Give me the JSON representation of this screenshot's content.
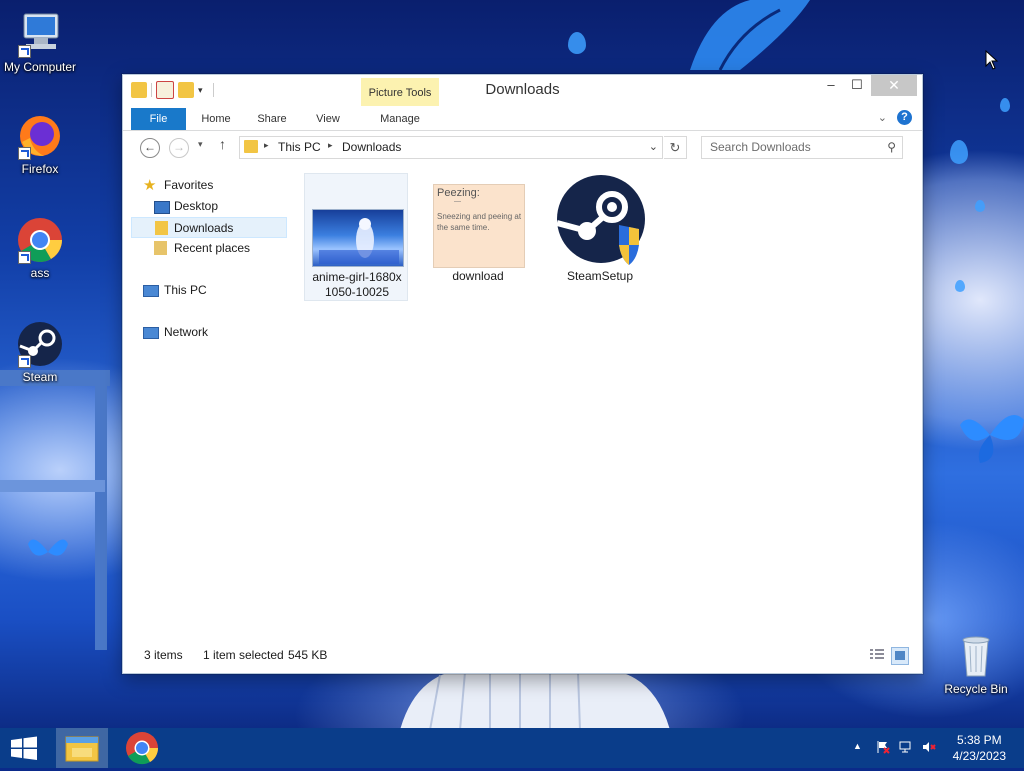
{
  "desktop": {
    "icons": [
      {
        "label": "My Computer",
        "icon": "computer-icon"
      },
      {
        "label": "Firefox",
        "icon": "firefox-icon"
      },
      {
        "label": "ass",
        "icon": "chrome-icon"
      },
      {
        "label": "Steam",
        "icon": "steam-icon"
      },
      {
        "label": "Recycle Bin",
        "icon": "recycle-bin-icon"
      }
    ]
  },
  "window": {
    "title": "Downloads",
    "context_tab": "Picture Tools",
    "ribbon_tabs": [
      "File",
      "Home",
      "Share",
      "View",
      "Manage"
    ],
    "breadcrumb": [
      "This PC",
      "Downloads"
    ],
    "search_placeholder": "Search Downloads",
    "nav_pane": {
      "favorites": "Favorites",
      "items": [
        "Desktop",
        "Downloads",
        "Recent places"
      ],
      "this_pc": "This PC",
      "network": "Network",
      "selected": "Downloads"
    },
    "files": [
      {
        "name": "anime-girl-1680x 1050-10025",
        "line1": "anime-girl-1680x",
        "line2": "1050-10025",
        "type": "image",
        "selected": true
      },
      {
        "name": "download",
        "line1": "download",
        "type": "note-image",
        "thumb_title": "Peezing:",
        "thumb_text": "Sneezing and peeing at the same time.",
        "selected": false
      },
      {
        "name": "SteamSetup",
        "line1": "SteamSetup",
        "type": "installer",
        "selected": false
      }
    ],
    "status": {
      "count": "3 items",
      "selection": "1 item selected",
      "size": "545 KB"
    }
  },
  "taskbar": {
    "pinned": [
      "start-icon",
      "file-explorer-icon",
      "chrome-icon"
    ],
    "clock_time": "5:38 PM",
    "clock_date": "4/23/2023"
  },
  "colors": {
    "accent": "#1979ca",
    "taskbar": "#0a3d8a",
    "context_tab": "#fcf2b0",
    "selection": "#e5f1fb"
  }
}
